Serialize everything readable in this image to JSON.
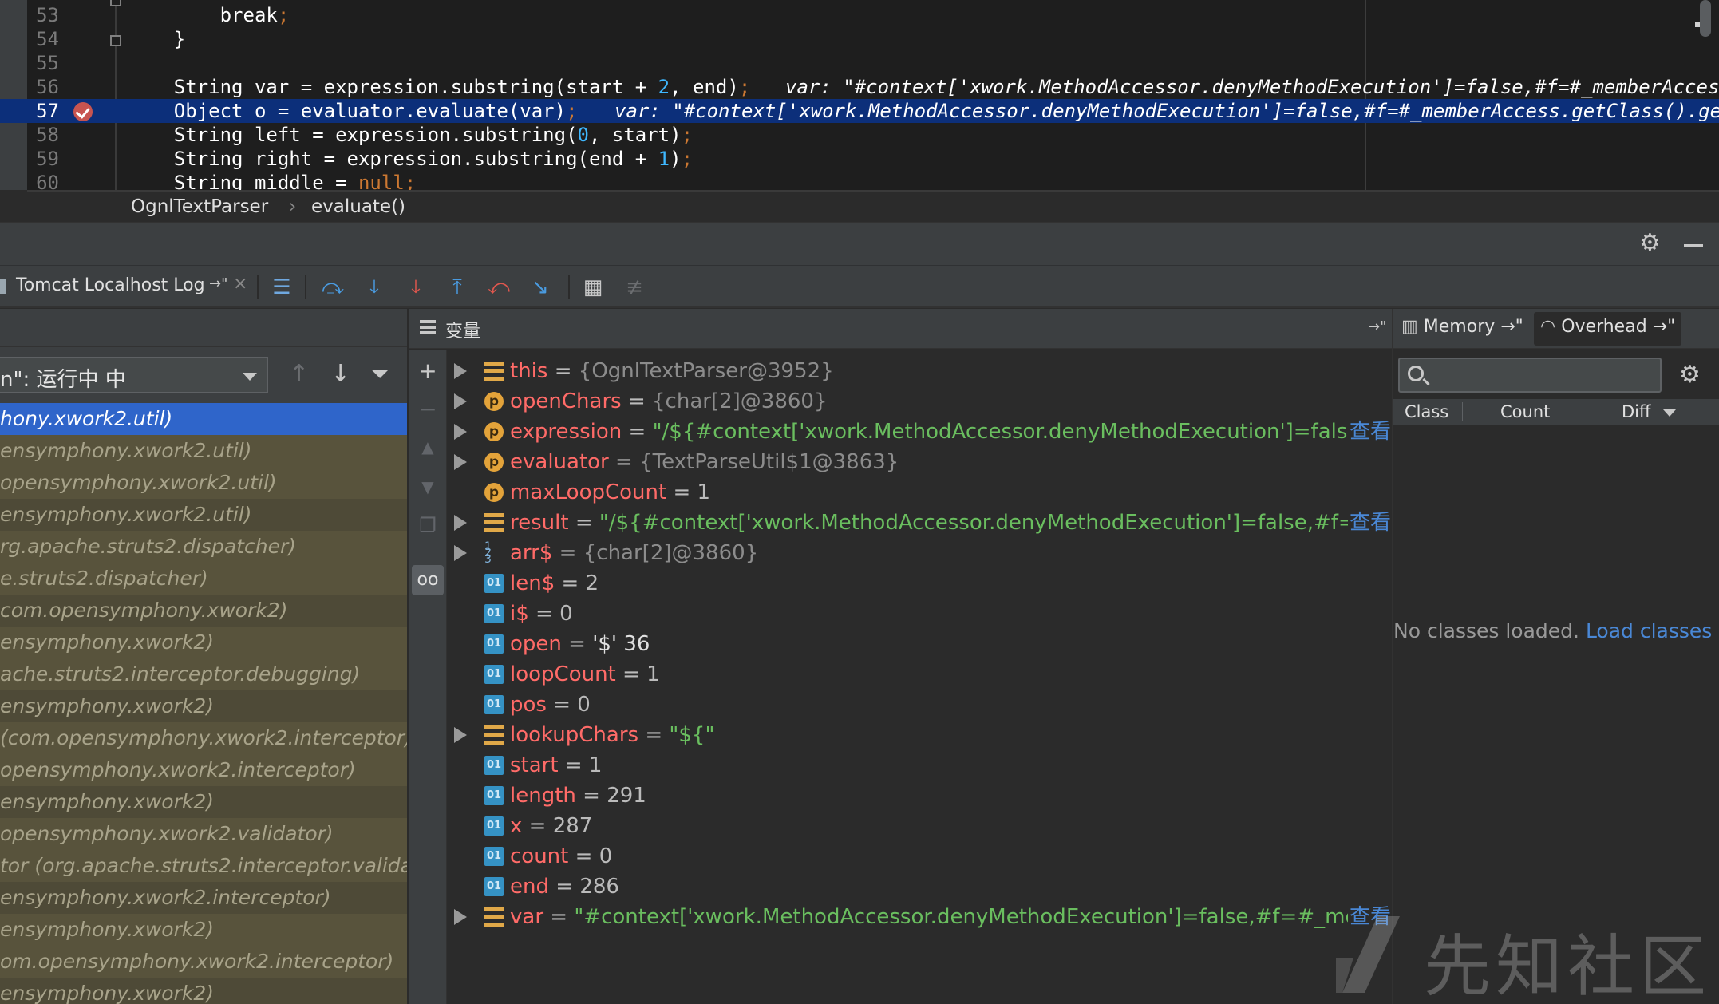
{
  "editor": {
    "lines": [
      {
        "num": "53",
        "code": "        break;",
        "kind": "break"
      },
      {
        "num": "54",
        "code": "    }",
        "kind": "plain"
      },
      {
        "num": "55",
        "code": "",
        "kind": "plain"
      },
      {
        "num": "56",
        "code": "    String var = expression.substring(start + 2, end);",
        "inline": "var: \"#context['xwork.MethodAccessor.denyMethodExecution']=false,#f=#_memberAccess.g",
        "kind": "plain"
      },
      {
        "num": "57",
        "code": "    Object o = evaluator.evaluate(var);",
        "inline": "var: \"#context['xwork.MethodAccessor.denyMethodExecution']=false,#f=#_memberAccess.getClass().getDe",
        "kind": "current"
      },
      {
        "num": "58",
        "code": "    String left = expression.substring(0, start);",
        "kind": "plain"
      },
      {
        "num": "59",
        "code": "    String right = expression.substring(end + 1);",
        "kind": "plain"
      },
      {
        "num": "60",
        "code": "    String middle = null;",
        "kind": "plain"
      }
    ],
    "breadcrumb": {
      "class": "OgnlTextParser",
      "separator": "›",
      "method": "evaluate()"
    }
  },
  "toolbar": {
    "tab_label": "Tomcat Localhost Log",
    "tab_pin": "→\"",
    "tab_close": "×"
  },
  "frames": {
    "thread_label": "n\": 运行中 中",
    "items": [
      {
        "text": "hony.xwork2.util)",
        "selected": true
      },
      {
        "text": "ensymphony.xwork2.util)"
      },
      {
        "text": "opensymphony.xwork2.util)"
      },
      {
        "text": "ensymphony.xwork2.util)"
      },
      {
        "text": "rg.apache.struts2.dispatcher)"
      },
      {
        "text": "e.struts2.dispatcher)"
      },
      {
        "text": "com.opensymphony.xwork2)"
      },
      {
        "text": "ensymphony.xwork2)"
      },
      {
        "text": "ache.struts2.interceptor.debugging)"
      },
      {
        "text": "ensymphony.xwork2)"
      },
      {
        "text": " (com.opensymphony.xwork2.interceptor)"
      },
      {
        "text": "opensymphony.xwork2.interceptor)"
      },
      {
        "text": "ensymphony.xwork2)"
      },
      {
        "text": "opensymphony.xwork2.validator)"
      },
      {
        "text": "tor (org.apache.struts2.interceptor.valida",
        "bold_prefix": "tor"
      },
      {
        "text": "ensymphony.xwork2.interceptor)"
      },
      {
        "text": "ensymphony.xwork2)"
      },
      {
        "text": "om.opensymphony.xwork2.interceptor)"
      },
      {
        "text": "ensymphony.xwork2)"
      }
    ]
  },
  "variables": {
    "title": "变量",
    "pin": "→\"",
    "view_label": "查看",
    "items": [
      {
        "icon": "field-icon",
        "expand": true,
        "name": "this",
        "value": "{OgnlTextParser@3952}",
        "type": "ref"
      },
      {
        "icon": "property-icon",
        "expand": true,
        "name": "openChars",
        "value": "{char[2]@3860}",
        "type": "ref"
      },
      {
        "icon": "property-icon",
        "expand": true,
        "name": "expression",
        "value": "\"/${#context['xwork.MethodAccessor.denyMethodExecution']=false,#...",
        "type": "str",
        "view": true
      },
      {
        "icon": "property-icon",
        "expand": true,
        "name": "evaluator",
        "value": "{TextParseUtil$1@3863}",
        "type": "ref"
      },
      {
        "icon": "property-icon",
        "expand": false,
        "name": "maxLoopCount",
        "value": "1",
        "type": "num"
      },
      {
        "icon": "field-icon",
        "expand": true,
        "name": "result",
        "value": "\"/${#context['xwork.MethodAccessor.denyMethodExecution']=false,#f=#_...",
        "type": "str",
        "view": true
      },
      {
        "icon": "array-icon",
        "expand": true,
        "name": "arr$",
        "value": "{char[2]@3860}",
        "type": "ref"
      },
      {
        "icon": "primitive-icon",
        "expand": false,
        "name": "len$",
        "value": "2",
        "type": "num"
      },
      {
        "icon": "primitive-icon",
        "expand": false,
        "name": "i$",
        "value": "0",
        "type": "num"
      },
      {
        "icon": "primitive-icon",
        "expand": false,
        "name": "open",
        "value": "'$' 36",
        "type": "char"
      },
      {
        "icon": "primitive-icon",
        "expand": false,
        "name": "loopCount",
        "value": "1",
        "type": "num"
      },
      {
        "icon": "primitive-icon",
        "expand": false,
        "name": "pos",
        "value": "0",
        "type": "num"
      },
      {
        "icon": "field-icon",
        "expand": true,
        "name": "lookupChars",
        "value": "\"${\"",
        "type": "str"
      },
      {
        "icon": "primitive-icon",
        "expand": false,
        "name": "start",
        "value": "1",
        "type": "num"
      },
      {
        "icon": "primitive-icon",
        "expand": false,
        "name": "length",
        "value": "291",
        "type": "num"
      },
      {
        "icon": "primitive-icon",
        "expand": false,
        "name": "x",
        "value": "287",
        "type": "num"
      },
      {
        "icon": "primitive-icon",
        "expand": false,
        "name": "count",
        "value": "0",
        "type": "num"
      },
      {
        "icon": "primitive-icon",
        "expand": false,
        "name": "end",
        "value": "286",
        "type": "num"
      },
      {
        "icon": "field-icon",
        "expand": true,
        "name": "var",
        "value": "\"#context['xwork.MethodAccessor.denyMethodExecution']=false,#f=#_memb...",
        "type": "str",
        "view": true
      }
    ]
  },
  "memory": {
    "tab_memory": "Memory →\"",
    "tab_overhead": "Overhead →\"",
    "col_class": "Class",
    "col_count": "Count",
    "col_diff": "Diff",
    "empty_text": "No classes loaded.",
    "load_link": "Load classes"
  },
  "watermark": "先知社区",
  "colors": {
    "current_line": "#0c2f7a",
    "selected_frame": "#2f65ca",
    "var_name": "#ff6b68",
    "string_value": "#6abe5f",
    "link": "#4a88d6"
  }
}
